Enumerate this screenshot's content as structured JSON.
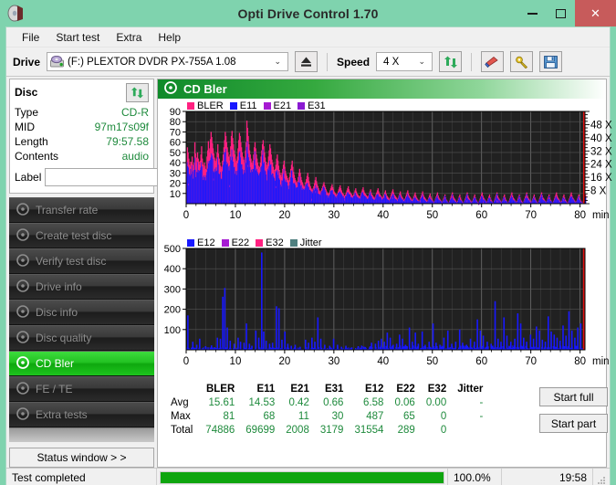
{
  "window": {
    "title": "Opti Drive Control 1.70",
    "app_icon": "disc-icon",
    "minimize": "–",
    "maximize": "□",
    "close": "✕"
  },
  "menu": {
    "items": [
      "File",
      "Start test",
      "Extra",
      "Help"
    ]
  },
  "toolbar": {
    "drive_label": "Drive",
    "drive_value": "(F:)   PLEXTOR DVDR   PX-755A 1.08",
    "drive_icon": "drive-icon",
    "eject_icon": "eject-icon",
    "speed_label": "Speed",
    "speed_value": "4 X",
    "refresh_icon": "refresh-icon",
    "erase_icon": "eraser-icon",
    "tools_icon": "tools-icon",
    "save_icon": "save-icon",
    "dropdown_arrow": "⌄"
  },
  "disc": {
    "header": "Disc",
    "refresh_icon": "refresh-icon",
    "rows": [
      {
        "key": "Type",
        "value": "CD-R"
      },
      {
        "key": "MID",
        "value": "97m17s09f"
      },
      {
        "key": "Length",
        "value": "79:57.58"
      },
      {
        "key": "Contents",
        "value": "audio"
      }
    ],
    "label_key": "Label",
    "label_value": "",
    "label_placeholder": "",
    "label_icon": "cd-icon"
  },
  "sidebar": {
    "items": [
      {
        "label": "Transfer rate",
        "icon": "disc-transfer-icon",
        "active": false
      },
      {
        "label": "Create test disc",
        "icon": "disc-create-icon",
        "active": false
      },
      {
        "label": "Verify test disc",
        "icon": "disc-verify-icon",
        "active": false
      },
      {
        "label": "Drive info",
        "icon": "disc-drive-icon",
        "active": false
      },
      {
        "label": "Disc info",
        "icon": "disc-info-icon",
        "active": false
      },
      {
        "label": "Disc quality",
        "icon": "disc-quality-icon",
        "active": false
      },
      {
        "label": "CD Bler",
        "icon": "disc-bler-icon",
        "active": true
      },
      {
        "label": "FE / TE",
        "icon": "disc-fete-icon",
        "active": false
      },
      {
        "label": "Extra tests",
        "icon": "disc-extra-icon",
        "active": false
      }
    ],
    "status_window_button": "Status window > >"
  },
  "content": {
    "title": "CD Bler",
    "title_icon": "disc-bler-icon",
    "start_full": "Start full",
    "start_part": "Start part"
  },
  "chart_data": [
    {
      "type": "area",
      "name": "bler-chart",
      "title": "",
      "xlabel": "min",
      "ylabel": "",
      "xlim": [
        0,
        81
      ],
      "ylim": [
        0,
        90
      ],
      "xticks": [
        0,
        10,
        20,
        30,
        40,
        50,
        60,
        70,
        80
      ],
      "xticklabels": [
        "0",
        "10",
        "20",
        "30",
        "40",
        "50",
        "60",
        "70",
        "80"
      ],
      "yticks": [
        10,
        20,
        30,
        40,
        50,
        60,
        70,
        80,
        90
      ],
      "yticklabels": [
        "10",
        "20",
        "30",
        "40",
        "50",
        "60",
        "70",
        "80",
        "90"
      ],
      "secondary_axis": {
        "label": "X",
        "ticks": [
          8,
          16,
          24,
          32,
          40,
          48
        ],
        "ticklabels": [
          "8 X",
          "16 X",
          "24 X",
          "32 X",
          "40 X",
          "48 X"
        ],
        "range": [
          0,
          56
        ]
      },
      "grid": true,
      "legend_position": "top-left",
      "series": [
        {
          "name": "BLER",
          "color": "#ff2080"
        },
        {
          "name": "E11",
          "color": "#1818ff"
        },
        {
          "name": "E21",
          "color": "#a61ad2"
        },
        {
          "name": "E31",
          "color": "#8a1ad2"
        }
      ],
      "bler_profile": [
        41,
        55,
        50,
        44,
        38,
        36,
        41,
        40,
        46,
        38,
        34,
        40,
        60,
        49,
        40,
        45,
        50,
        44,
        41,
        38,
        42,
        48,
        56,
        44,
        38,
        35,
        40,
        37,
        34,
        33,
        46,
        52,
        61,
        54,
        50,
        63,
        70,
        65,
        59,
        54,
        49,
        45,
        42,
        40,
        44,
        50,
        58,
        49,
        44,
        40,
        37,
        34,
        36,
        42,
        48,
        55,
        62,
        70,
        66,
        60,
        55,
        50,
        46,
        42,
        48,
        56,
        66,
        71,
        64,
        58,
        52,
        48,
        44,
        40,
        42,
        46,
        54,
        62,
        69,
        66,
        60,
        55,
        50,
        46,
        43,
        40,
        45,
        52,
        60,
        81,
        74,
        66,
        58,
        52,
        48,
        44,
        40,
        38,
        42,
        48,
        55,
        60,
        54,
        48,
        44,
        40,
        37,
        34,
        36,
        40,
        46,
        52,
        58,
        62,
        56,
        50,
        45,
        41,
        38,
        35,
        40,
        46,
        52,
        58,
        54,
        48,
        43,
        40,
        36,
        33,
        30,
        34,
        38,
        44,
        48,
        42,
        37,
        33,
        30,
        28,
        26,
        30,
        34,
        38,
        42,
        36,
        32,
        29,
        27,
        25,
        23,
        22,
        26,
        30,
        34,
        38,
        42,
        36,
        31,
        28,
        25,
        23,
        21,
        19,
        22,
        26,
        30,
        34,
        30,
        26,
        23,
        21,
        19,
        17,
        16,
        18,
        21,
        24,
        27,
        30,
        26,
        22,
        19,
        17,
        15,
        14,
        13,
        15,
        17,
        20,
        23,
        26,
        22,
        19,
        17,
        15,
        13,
        12,
        11,
        13,
        15,
        17,
        19,
        21,
        18,
        16,
        14,
        12,
        11,
        10,
        9,
        11,
        13,
        15,
        17,
        19,
        16,
        14,
        12,
        11,
        10,
        9,
        8,
        10,
        12,
        14,
        16,
        18,
        15,
        13,
        11,
        10,
        9,
        8,
        7,
        9,
        11,
        13,
        15,
        17,
        14,
        12,
        11,
        10,
        9,
        8,
        7,
        9,
        11,
        13,
        15,
        12,
        10,
        9,
        8,
        7,
        6,
        8,
        10,
        12,
        14,
        16,
        13,
        11,
        10,
        9,
        8,
        7,
        6,
        8,
        10,
        12,
        14,
        11,
        9,
        8,
        7,
        6,
        5,
        7,
        9,
        11,
        13,
        15,
        12,
        10,
        9,
        8,
        7,
        6,
        5,
        7,
        9,
        11,
        13,
        10,
        8,
        7,
        6,
        5,
        4,
        6,
        8,
        10,
        12,
        14,
        11,
        9,
        8,
        7,
        6,
        5,
        4,
        6,
        8,
        10,
        12,
        9,
        7,
        6,
        5,
        4,
        3,
        5,
        7,
        9,
        11,
        13,
        10,
        8,
        7,
        6,
        5,
        4,
        3,
        5,
        7,
        9,
        11,
        8,
        6,
        5,
        4,
        3,
        2,
        4,
        6,
        8,
        10,
        12,
        9,
        7,
        6,
        5,
        4,
        3,
        2,
        4,
        6,
        8,
        10,
        7,
        5,
        4,
        3,
        2,
        1,
        3,
        5,
        7,
        9,
        11,
        8,
        6,
        5,
        4,
        3,
        2,
        1,
        3,
        5,
        7,
        9,
        6,
        4,
        3,
        2,
        1,
        1,
        3,
        5,
        7,
        9,
        11,
        8,
        6,
        5,
        4,
        3,
        2,
        1,
        3,
        5,
        7,
        9,
        6,
        4,
        3,
        2,
        1,
        1,
        3,
        5,
        7,
        9,
        11,
        8,
        6,
        5,
        4,
        3,
        2,
        1,
        3,
        5,
        7,
        9,
        6,
        4,
        3,
        2,
        1,
        1,
        3,
        5,
        7,
        9,
        11,
        8,
        6,
        5,
        4,
        3,
        2,
        1,
        3,
        5,
        7,
        9,
        6,
        4,
        3,
        2,
        1,
        1,
        3,
        5,
        7,
        9,
        11,
        8,
        6,
        5,
        4,
        3,
        2,
        1,
        3,
        5,
        7,
        9,
        6,
        4,
        3,
        2,
        1,
        1,
        3,
        5,
        7,
        9,
        11,
        8,
        6,
        5,
        4,
        3,
        2,
        1,
        3,
        5,
        7,
        9,
        6,
        4,
        3,
        2,
        1,
        1,
        3,
        5,
        7,
        9,
        11,
        8,
        6,
        5,
        4,
        3,
        2,
        1,
        3,
        5,
        7,
        9,
        6,
        4,
        3,
        2,
        1,
        1,
        3,
        5,
        7,
        9,
        11,
        8,
        6,
        5,
        4,
        3,
        2,
        1,
        3,
        5,
        7,
        9,
        6,
        4,
        3,
        2,
        1,
        1,
        3,
        5,
        7,
        9,
        11,
        8,
        6,
        5,
        4,
        3,
        2,
        1,
        3,
        5,
        7,
        9,
        6,
        4,
        3,
        2,
        1,
        1,
        3,
        5,
        7,
        9,
        11,
        8,
        6,
        5,
        4,
        3,
        2,
        1,
        3,
        5,
        7,
        9,
        6,
        4,
        3,
        2,
        1,
        1,
        3,
        5,
        7,
        9
      ],
      "e11_ratio": 0.86
    },
    {
      "type": "line",
      "name": "e12-chart",
      "title": "",
      "xlabel": "min",
      "ylabel": "",
      "xlim": [
        0,
        81
      ],
      "ylim": [
        0,
        500
      ],
      "xticks": [
        0,
        10,
        20,
        30,
        40,
        50,
        60,
        70,
        80
      ],
      "xticklabels": [
        "0",
        "10",
        "20",
        "30",
        "40",
        "50",
        "60",
        "70",
        "80"
      ],
      "yticks": [
        100,
        200,
        300,
        400,
        500
      ],
      "yticklabels": [
        "100",
        "200",
        "300",
        "400",
        "500"
      ],
      "grid": true,
      "legend_position": "top-left",
      "series": [
        {
          "name": "E12",
          "color": "#1818ff"
        },
        {
          "name": "E22",
          "color": "#a61ad2"
        },
        {
          "name": "E32",
          "color": "#ff2080"
        },
        {
          "name": "Jitter",
          "color": "#4f7f7f"
        }
      ],
      "e12_spikes": [
        [
          0.2,
          170
        ],
        [
          1.2,
          40
        ],
        [
          2.0,
          25
        ],
        [
          2.6,
          55
        ],
        [
          3.8,
          18
        ],
        [
          5.0,
          22
        ],
        [
          6.2,
          60
        ],
        [
          6.8,
          55
        ],
        [
          7.3,
          262
        ],
        [
          7.7,
          305
        ],
        [
          8.2,
          110
        ],
        [
          8.8,
          45
        ],
        [
          9.6,
          30
        ],
        [
          10.4,
          60
        ],
        [
          10.9,
          40
        ],
        [
          11.6,
          35
        ],
        [
          12.1,
          130
        ],
        [
          12.7,
          30
        ],
        [
          13.2,
          20
        ],
        [
          14.0,
          95
        ],
        [
          14.6,
          60
        ],
        [
          15.2,
          480
        ],
        [
          15.6,
          90
        ],
        [
          16.1,
          45
        ],
        [
          16.8,
          30
        ],
        [
          17.4,
          35
        ],
        [
          18.2,
          215
        ],
        [
          18.7,
          205
        ],
        [
          19.3,
          50
        ],
        [
          19.9,
          90
        ],
        [
          20.5,
          30
        ],
        [
          21.2,
          20
        ],
        [
          22.0,
          25
        ],
        [
          23.0,
          15
        ],
        [
          24.1,
          50
        ],
        [
          24.7,
          35
        ],
        [
          25.4,
          60
        ],
        [
          26.0,
          40
        ],
        [
          26.6,
          160
        ],
        [
          27.2,
          55
        ],
        [
          28.0,
          25
        ],
        [
          29.0,
          20
        ],
        [
          29.8,
          55
        ],
        [
          30.6,
          25
        ],
        [
          31.4,
          15
        ],
        [
          32.3,
          20
        ],
        [
          33.5,
          12
        ],
        [
          34.8,
          18
        ],
        [
          36.0,
          15
        ],
        [
          37.5,
          35
        ],
        [
          38.3,
          30
        ],
        [
          38.9,
          45
        ],
        [
          39.5,
          55
        ],
        [
          40.1,
          40
        ],
        [
          40.7,
          85
        ],
        [
          41.3,
          60
        ],
        [
          41.9,
          25
        ],
        [
          42.6,
          30
        ],
        [
          43.2,
          75
        ],
        [
          43.8,
          55
        ],
        [
          44.4,
          25
        ],
        [
          45.2,
          110
        ],
        [
          45.8,
          40
        ],
        [
          46.4,
          85
        ],
        [
          47.0,
          30
        ],
        [
          47.8,
          90
        ],
        [
          48.4,
          25
        ],
        [
          49.2,
          40
        ],
        [
          50.0,
          130
        ],
        [
          50.6,
          35
        ],
        [
          51.4,
          25
        ],
        [
          52.2,
          60
        ],
        [
          53.0,
          95
        ],
        [
          53.8,
          30
        ],
        [
          54.6,
          40
        ],
        [
          55.4,
          100
        ],
        [
          56.0,
          35
        ],
        [
          56.8,
          25
        ],
        [
          57.6,
          55
        ],
        [
          58.4,
          40
        ],
        [
          59.0,
          150
        ],
        [
          59.6,
          95
        ],
        [
          60.2,
          70
        ],
        [
          61.0,
          40
        ],
        [
          61.8,
          30
        ],
        [
          62.6,
          240
        ],
        [
          63.2,
          55
        ],
        [
          63.8,
          40
        ],
        [
          64.4,
          160
        ],
        [
          65.0,
          70
        ],
        [
          65.8,
          40
        ],
        [
          66.6,
          55
        ],
        [
          67.2,
          180
        ],
        [
          67.8,
          130
        ],
        [
          68.4,
          60
        ],
        [
          69.0,
          40
        ],
        [
          69.8,
          75
        ],
        [
          70.4,
          55
        ],
        [
          71.0,
          115
        ],
        [
          71.6,
          95
        ],
        [
          72.2,
          50
        ],
        [
          72.8,
          40
        ],
        [
          73.4,
          165
        ],
        [
          74.0,
          90
        ],
        [
          74.6,
          75
        ],
        [
          75.2,
          60
        ],
        [
          75.8,
          45
        ],
        [
          76.4,
          120
        ],
        [
          77.0,
          70
        ],
        [
          77.6,
          190
        ],
        [
          78.2,
          95
        ],
        [
          78.8,
          60
        ],
        [
          79.4,
          110
        ],
        [
          80.0,
          130
        ]
      ],
      "end_marker": {
        "x": 80.6,
        "color": "#e01010"
      }
    }
  ],
  "stats": {
    "columns": [
      "BLER",
      "E11",
      "E21",
      "E31",
      "E12",
      "E22",
      "E32",
      "Jitter"
    ],
    "rows": [
      {
        "label": "Avg",
        "values": [
          "15.61",
          "14.53",
          "0.42",
          "0.66",
          "6.58",
          "0.06",
          "0.00",
          "-"
        ]
      },
      {
        "label": "Max",
        "values": [
          "81",
          "68",
          "11",
          "30",
          "487",
          "65",
          "0",
          "-"
        ]
      },
      {
        "label": "Total",
        "values": [
          "74886",
          "69699",
          "2008",
          "3179",
          "31554",
          "289",
          "0",
          ""
        ]
      }
    ]
  },
  "statusbar": {
    "text": "Test completed",
    "progress_percent": 100,
    "percent_label": "100.0%",
    "time": "19:58"
  }
}
